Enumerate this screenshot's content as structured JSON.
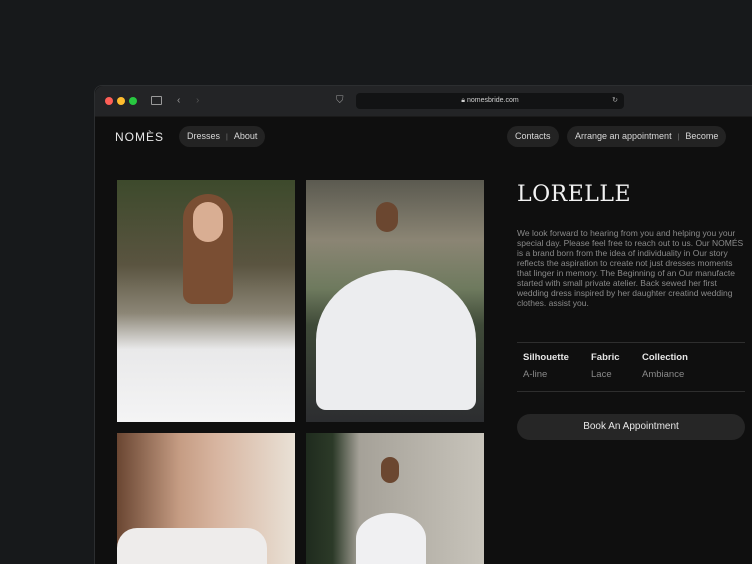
{
  "browser": {
    "url": "nomesbride.com"
  },
  "site": {
    "logo": "NOMÈS",
    "nav_left": [
      "Dresses",
      "About"
    ],
    "contacts": "Contacts",
    "nav_right": [
      "Arrange an appointment",
      "Become"
    ]
  },
  "product": {
    "title": "LORELLE",
    "description": [
      "We look forward to hearing from you and helping you",
      "your special day. Please feel free to reach out to us. Our",
      "NOMÉS is a brand born from the idea of individuality in",
      "Our story reflects the aspiration to create not just dresses",
      "moments that linger in memory. The Beginning of an",
      "Our manufacte started with small private atelier. Back",
      "sewed her first wedding dress inspired by her daughter",
      "creatind wedding clothes. assist you."
    ],
    "specs": [
      {
        "label": "Silhouette",
        "value": "A-line"
      },
      {
        "label": "Fabric",
        "value": "Lace"
      },
      {
        "label": "Collection",
        "value": "Ambiance"
      }
    ],
    "book_label": "Book An Appointment"
  }
}
